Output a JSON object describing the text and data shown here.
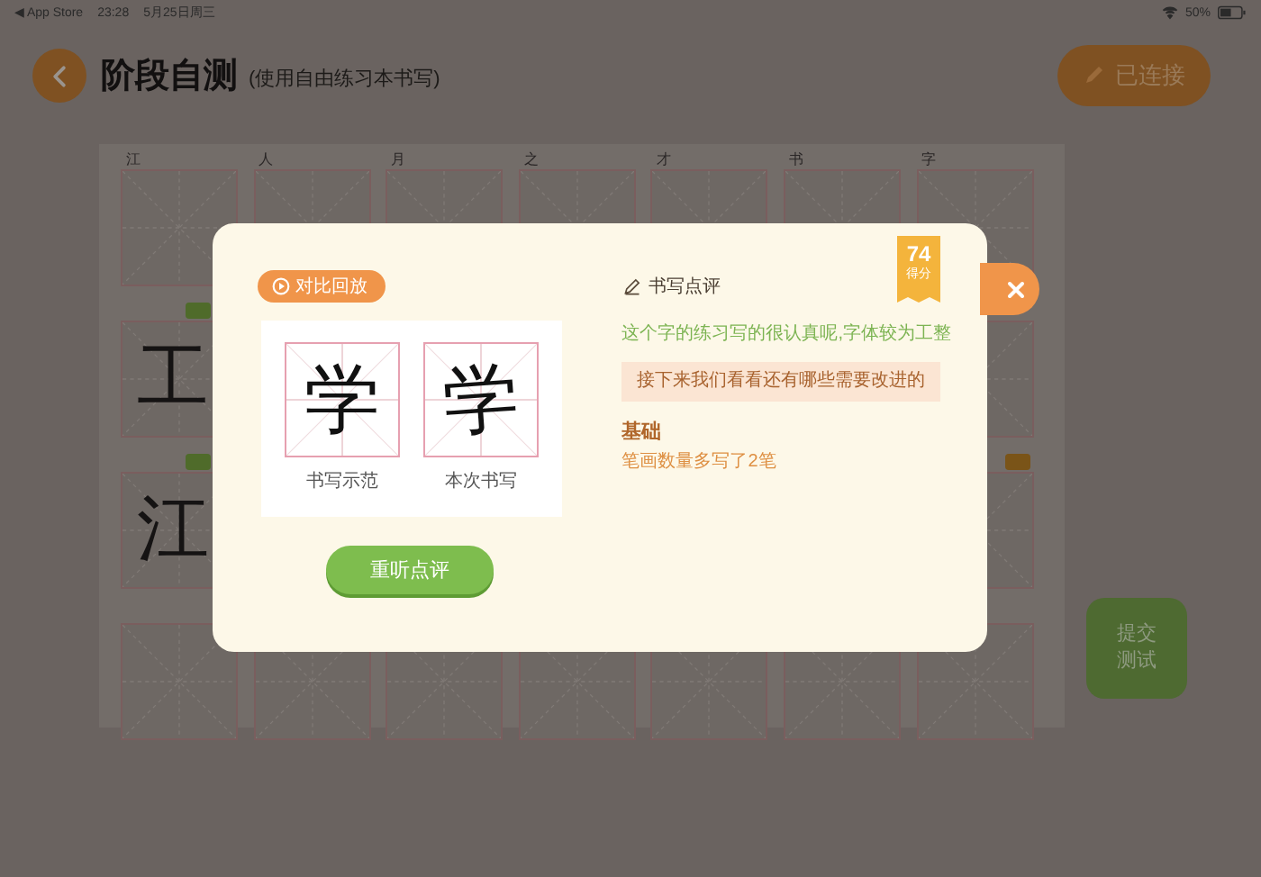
{
  "status_bar": {
    "back_label": "◀ App Store",
    "time": "23:28",
    "date": "5月25日周三",
    "battery": "50%"
  },
  "header": {
    "title": "阶段自测",
    "subtitle": "(使用自由练习本书写)",
    "connect_button": "已连接"
  },
  "practice_grid": {
    "rows": [
      {
        "cells": [
          {
            "label": "江"
          },
          {
            "label": "人"
          },
          {
            "label": "月"
          },
          {
            "label": "之"
          },
          {
            "label": "才"
          },
          {
            "label": "书"
          },
          {
            "label": "字"
          }
        ]
      },
      {
        "cells": [
          {
            "char": "工",
            "color": "#4f6b2a"
          },
          {}
        ]
      },
      {
        "cells": [
          {
            "char": "江",
            "color": "#4f6b2a"
          },
          {
            "color": "#7a5418"
          }
        ]
      },
      {
        "cells": [
          {},
          {},
          {},
          {},
          {},
          {},
          {}
        ]
      }
    ]
  },
  "submit_button": [
    "提交",
    "测试"
  ],
  "modal": {
    "replay_button": "对比回放",
    "samples": [
      {
        "kind": "model",
        "char": "学",
        "caption": "书写示范"
      },
      {
        "kind": "handwritten",
        "char": "学",
        "caption": "本次书写"
      }
    ],
    "relisten_button": "重听点评",
    "review": {
      "title": "书写点评",
      "score": "74",
      "score_label": "得分",
      "praise": "这个字的练习写的很认真呢,字体较为工整",
      "prompt": "接下来我们看看还有哪些需要改进的",
      "issues": [
        {
          "category": "基础",
          "detail": "笔画数量多写了2笔"
        }
      ]
    }
  }
}
